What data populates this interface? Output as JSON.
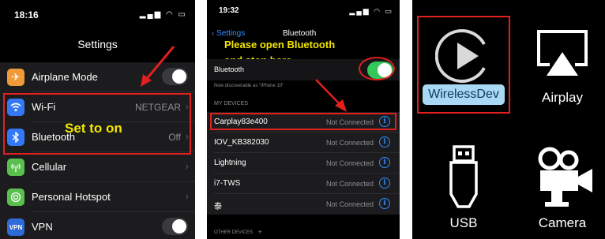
{
  "settings_panel": {
    "time": "18:16",
    "title": "Settings",
    "annotation": "Set to on",
    "rows": [
      {
        "label": "Airplane Mode",
        "value": "",
        "icon": "airplane-icon",
        "color": "#f09a37"
      },
      {
        "label": "Wi-Fi",
        "value": "NETGEAR",
        "icon": "wifi-icon",
        "color": "#3478f6"
      },
      {
        "label": "Bluetooth",
        "value": "Off",
        "icon": "bluetooth-icon",
        "color": "#3478f6"
      },
      {
        "label": "Cellular",
        "value": "",
        "icon": "cellular-icon",
        "color": "#5bbf4f"
      },
      {
        "label": "Personal Hotspot",
        "value": "",
        "icon": "hotspot-icon",
        "color": "#5bbf4f"
      },
      {
        "label": "VPN",
        "value": "",
        "icon": "vpn-icon",
        "color": "#2f6ad9"
      }
    ]
  },
  "bluetooth_panel": {
    "time": "19:32",
    "back_label": "Settings",
    "title": "Bluetooth",
    "annotation_line1": "Please open Bluetooth",
    "annotation_line2": "and stop here",
    "bluetooth_label": "Bluetooth",
    "discoverable": "Now discoverable as \"iPhone 10\"",
    "my_devices_header": "MY DEVICES",
    "other_devices_header": "OTHER DEVICES",
    "devices": [
      {
        "name": "Carplay83e400",
        "state": "Not Connected"
      },
      {
        "name": "IOV_KB382030",
        "state": "Not Connected"
      },
      {
        "name": "Lightning",
        "state": "Not Connected"
      },
      {
        "name": "i7-TWS",
        "state": "Not Connected"
      },
      {
        "name": "泰",
        "state": "Not Connected"
      }
    ]
  },
  "menu_panel": {
    "tiles": [
      {
        "label": "WirelessDev",
        "icon": "play-icon"
      },
      {
        "label": "Airplay",
        "icon": "airplay-icon"
      },
      {
        "label": "USB",
        "icon": "usb-icon"
      },
      {
        "label": "Camera",
        "icon": "camera-icon"
      }
    ],
    "highlight_color": "#a9d8f4"
  },
  "colors": {
    "annotation": "#f2e600",
    "red_box": "#e0201e",
    "ios_blue": "#2f8cff",
    "toggle_green": "#34c759"
  }
}
